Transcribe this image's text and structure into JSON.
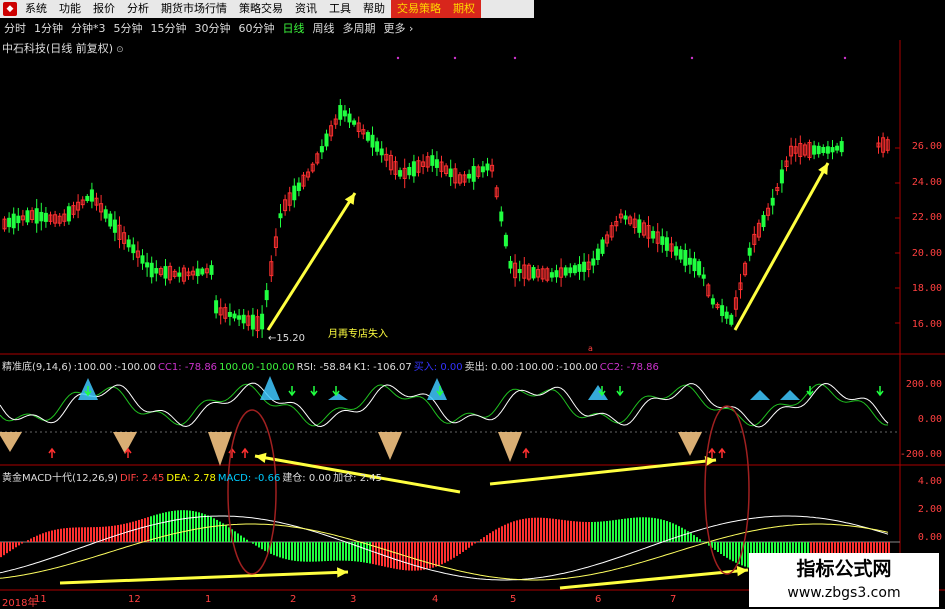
{
  "menu": {
    "items": [
      "系统",
      "功能",
      "报价",
      "分析",
      "期货市场行情",
      "策略交易",
      "资讯",
      "工具",
      "帮助",
      "交易策略",
      "期权"
    ],
    "highlight_index": 9
  },
  "periods": {
    "items": [
      "分时",
      "1分钟",
      "分钟*3",
      "5分钟",
      "15分钟",
      "30分钟",
      "60分钟",
      "日线",
      "周线",
      "多周期",
      "更多"
    ],
    "selected_index": 7
  },
  "chart_title": "中石科技(日线 前复权)",
  "price_axis": [
    "26.00",
    "24.00",
    "22.00",
    "20.00",
    "18.00",
    "16.00"
  ],
  "low_marker": "15.20",
  "buy_note": "月再专店失入",
  "red_mark": "a",
  "indicator1": {
    "parts": [
      {
        "t": "精准底(9,14,6)",
        "c": "#dddddd"
      },
      {
        "t": ":100.00",
        "c": "#dddddd"
      },
      {
        "t": ":-100.00",
        "c": "#dddddd"
      },
      {
        "t": "CC1: -78.86",
        "c": "#cc33cc"
      },
      {
        "t": "100.00",
        "c": "#3cf43c"
      },
      {
        "t": "-100.00",
        "c": "#3cf43c"
      },
      {
        "t": "RSI: -58.84",
        "c": "#dddddd"
      },
      {
        "t": "K1: -106.07",
        "c": "#dddddd"
      },
      {
        "t": "买入: 0.00",
        "c": "#3333ff"
      },
      {
        "t": "卖出: 0.00",
        "c": "#dddddd"
      },
      {
        "t": ":100.00",
        "c": "#dddddd"
      },
      {
        "t": ":-100.00",
        "c": "#dddddd"
      },
      {
        "t": "CC2: -78.86",
        "c": "#cc33cc"
      }
    ],
    "axis": [
      "200.00",
      "0.00",
      "-200.00"
    ]
  },
  "indicator2": {
    "parts": [
      {
        "t": "黄金MACD十代(12,26,9)",
        "c": "#dddddd"
      },
      {
        "t": "DIF: 2.45",
        "c": "#ff4040"
      },
      {
        "t": "DEA: 2.78",
        "c": "#ffff00"
      },
      {
        "t": "MACD: -0.66",
        "c": "#00ccff"
      },
      {
        "t": "建仓: 0.00",
        "c": "#dddddd"
      },
      {
        "t": "加仓: 2.45",
        "c": "#dddddd"
      }
    ],
    "axis": [
      "4.00",
      "2.00",
      "0.00"
    ]
  },
  "time_axis": [
    "2018年",
    "11",
    "12",
    "1",
    "2",
    "3",
    "4",
    "5",
    "6",
    "7"
  ],
  "watermark": {
    "title": "指标公式网",
    "url": "www.zbgs3.com"
  },
  "colors": {
    "up": "#ff3030",
    "down": "#20ff40",
    "arrow": "#ffff40",
    "grid": "#8b0000"
  }
}
